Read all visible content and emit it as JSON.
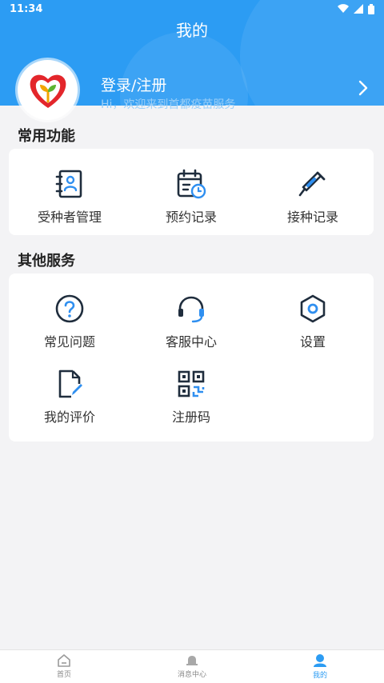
{
  "status": {
    "time": "11:34"
  },
  "header": {
    "title": "我的"
  },
  "profile": {
    "login_label": "登录/注册",
    "subtitle": "Hi，欢迎来到首都疫苗服务"
  },
  "common": {
    "title": "常用功能",
    "items": [
      {
        "label": "受种者管理",
        "icon": "person-book-icon"
      },
      {
        "label": "预约记录",
        "icon": "calendar-clock-icon"
      },
      {
        "label": "接种记录",
        "icon": "syringe-icon"
      }
    ]
  },
  "other": {
    "title": "其他服务",
    "items": [
      {
        "label": "常见问题",
        "icon": "question-icon"
      },
      {
        "label": "客服中心",
        "icon": "headset-icon"
      },
      {
        "label": "设置",
        "icon": "gear-icon"
      },
      {
        "label": "我的评价",
        "icon": "edit-document-icon"
      },
      {
        "label": "注册码",
        "icon": "qr-code-icon"
      }
    ]
  },
  "tabbar": {
    "items": [
      {
        "label": "首页",
        "icon": "home-icon"
      },
      {
        "label": "消息中心",
        "icon": "bell-icon"
      },
      {
        "label": "我的",
        "icon": "user-icon"
      }
    ],
    "active_index": 2
  },
  "colors": {
    "primary": "#2c9cf3",
    "accent": "#2f8ff0",
    "icon_dark": "#1f2d3d"
  }
}
